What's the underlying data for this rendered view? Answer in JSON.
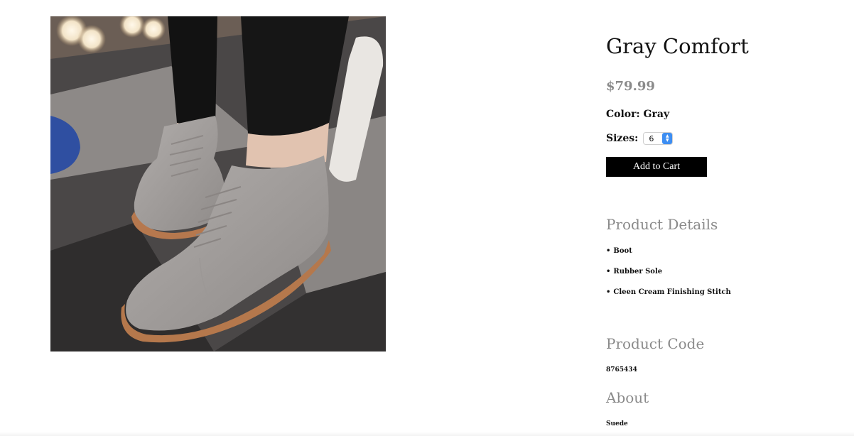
{
  "product": {
    "image_alt": "Gray suede lace-up ankle boots",
    "title": "Gray Comfort",
    "price": "$79.99",
    "color_label": "Color: Gray",
    "sizes_label": "Sizes:",
    "selected_size": "6",
    "add_to_cart_label": "Add to Cart"
  },
  "details": {
    "heading": "Product Details",
    "items": [
      "Boot",
      "Rubber Sole",
      "Cleen Cream Finishing Stitch"
    ]
  },
  "code": {
    "heading": "Product Code",
    "value": "8765434"
  },
  "about": {
    "heading": "About",
    "value": "Suede"
  },
  "colors": {
    "button_bg": "#000000",
    "heading_gray": "#8a8a8a",
    "select_accent": "#3d8ef2"
  },
  "icons": {
    "size_stepper": "chevron-up-down-icon"
  }
}
